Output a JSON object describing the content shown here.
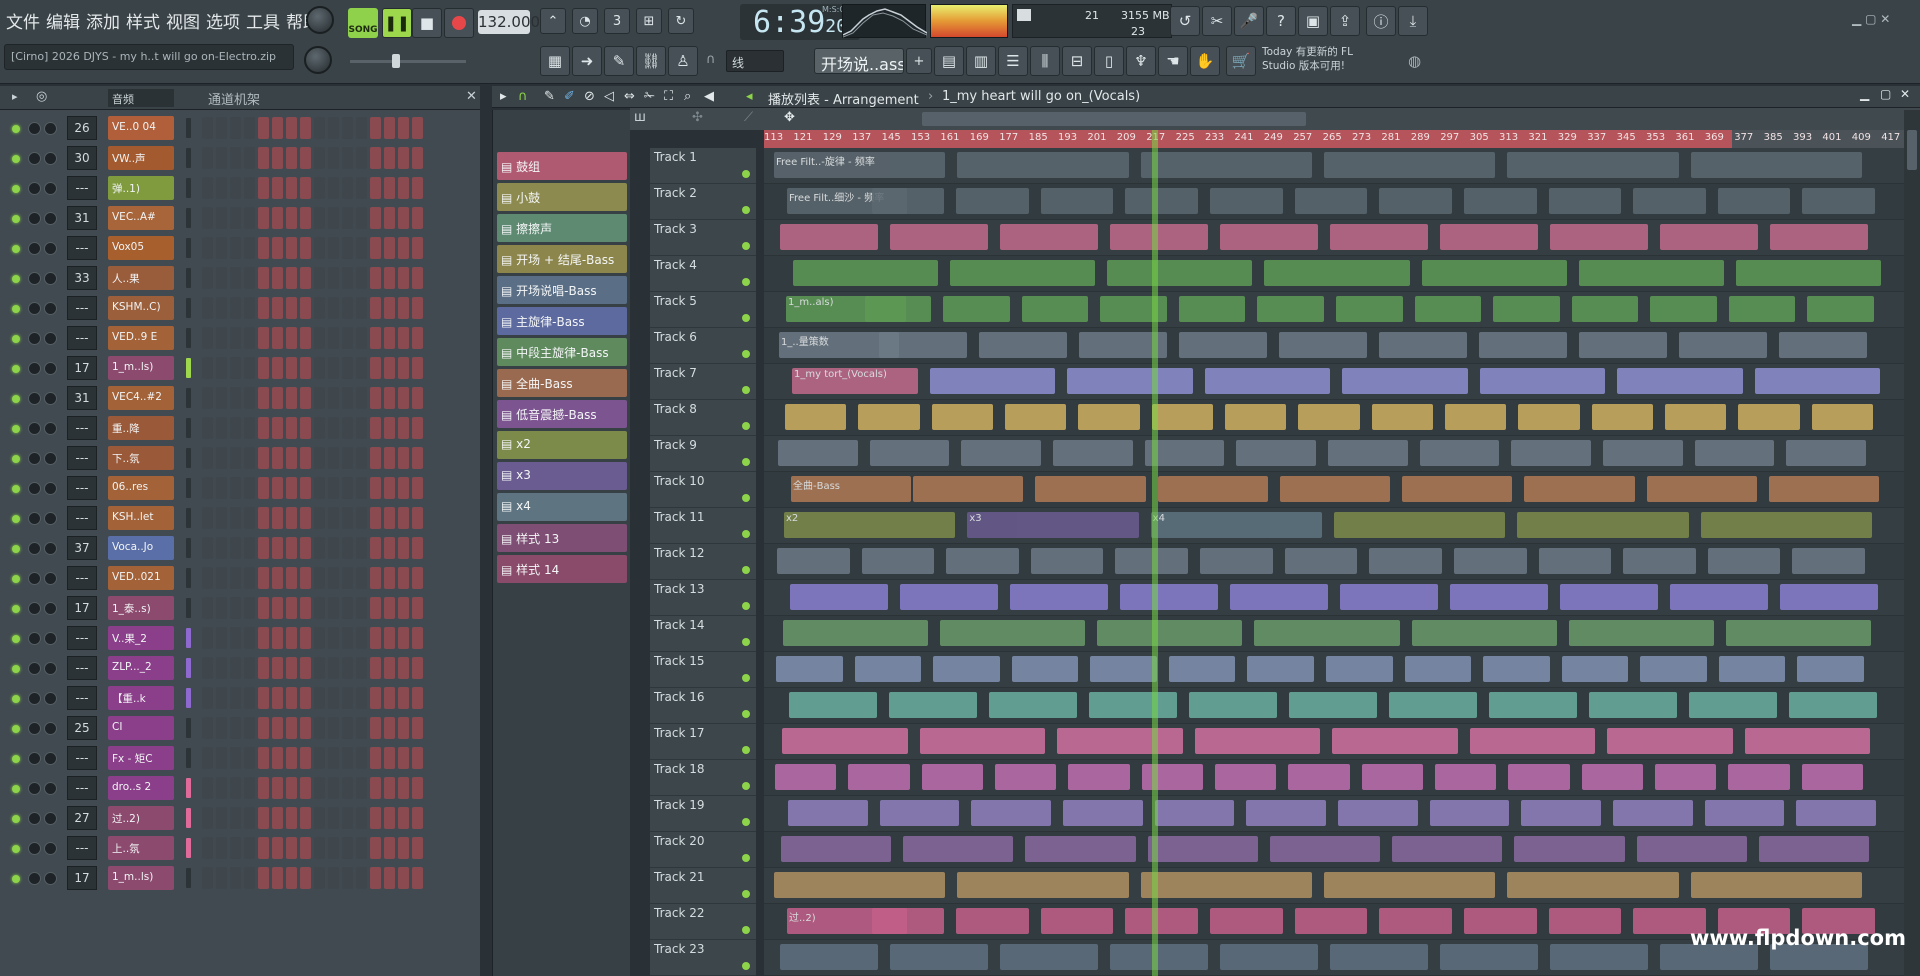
{
  "menu": [
    "文件",
    "编辑",
    "添加",
    "样式",
    "视图",
    "选项",
    "工具",
    "帮助"
  ],
  "song_info": "[Cirno] 2026 DJYS - my h..t will go on-Electro.zip",
  "transport": {
    "mode": "SONG",
    "tempo": "132.000",
    "time_main": "6:39",
    "time_sub": "20",
    "time_unit": "M:S:CS"
  },
  "cpu": {
    "cpu_value": "21",
    "mem": "3155 MB",
    "poly": "23"
  },
  "snap_label": "线",
  "current_pattern": "开场说..ass",
  "hint": {
    "line1": "Today  有更新的 FL",
    "line2": "Studio 版本可用!"
  },
  "rack_header": {
    "filter": "音频",
    "title": "通道机架"
  },
  "channels": [
    {
      "num": "26",
      "name": "VE..0 04",
      "color": "#b05f3a"
    },
    {
      "num": "30",
      "name": "VW..声",
      "color": "#a35a2e"
    },
    {
      "num": "---",
      "name": "弹..1)",
      "color": "#7f9b3e"
    },
    {
      "num": "31",
      "name": "VEC..A#",
      "color": "#a8653a"
    },
    {
      "num": "---",
      "name": "Vox05",
      "color": "#a85f2e"
    },
    {
      "num": "33",
      "name": "人..果",
      "color": "#9a5d3c"
    },
    {
      "num": "---",
      "name": "KSHM..C)",
      "color": "#9b5f3b"
    },
    {
      "num": "---",
      "name": "VED..9 E",
      "color": "#a36238"
    },
    {
      "num": "17",
      "name": "1_m..ls)",
      "color": "#8c4a6e"
    },
    {
      "num": "31",
      "name": "VEC4..#2",
      "color": "#a36238"
    },
    {
      "num": "---",
      "name": "重..降",
      "color": "#9a5a3a"
    },
    {
      "num": "---",
      "name": "下..氛",
      "color": "#9a5a3a"
    },
    {
      "num": "---",
      "name": "06..res",
      "color": "#a36238"
    },
    {
      "num": "---",
      "name": "KSH..let",
      "color": "#a36238"
    },
    {
      "num": "37",
      "name": "Voca..Jo",
      "color": "#5a6fa8"
    },
    {
      "num": "---",
      "name": "VED..021",
      "color": "#a36238"
    },
    {
      "num": "17",
      "name": "1_泰..s)",
      "color": "#8c4a6e"
    },
    {
      "num": "---",
      "name": "V..果_2",
      "color": "#8b3f8a"
    },
    {
      "num": "---",
      "name": "ZLP..._2",
      "color": "#8b3f8a"
    },
    {
      "num": "---",
      "name": "【重..k",
      "color": "#8b3f8a"
    },
    {
      "num": "25",
      "name": "CI",
      "color": "#8b3f8a"
    },
    {
      "num": "---",
      "name": "Fx - 矩C",
      "color": "#8b3f8a"
    },
    {
      "num": "---",
      "name": "dro..s 2",
      "color": "#8b3f8a"
    },
    {
      "num": "27",
      "name": "过..2)",
      "color": "#8c4a6e"
    },
    {
      "num": "---",
      "name": "上..氛",
      "color": "#8c4a6e"
    },
    {
      "num": "17",
      "name": "1_m..ls)",
      "color": "#8c4a6e"
    }
  ],
  "patterns": [
    {
      "name": "鼓组",
      "color": "#b05a72"
    },
    {
      "name": "小鼓",
      "color": "#8c8a4e"
    },
    {
      "name": "擦擦声",
      "color": "#5e8a72"
    },
    {
      "name": "开场 + 结尾-Bass",
      "color": "#8d864c"
    },
    {
      "name": "开场说唱-Bass",
      "color": "#5a6f86"
    },
    {
      "name": "主旋律-Bass",
      "color": "#5d6aa0"
    },
    {
      "name": "中段主旋律-Bass",
      "color": "#5f8a5e"
    },
    {
      "name": "全曲-Bass",
      "color": "#9a6a50"
    },
    {
      "name": "低音震撼-Bass",
      "color": "#7c5590"
    },
    {
      "name": "x2",
      "color": "#7d8b4a"
    },
    {
      "name": "x3",
      "color": "#6a5c90"
    },
    {
      "name": "x4",
      "color": "#5e7480"
    },
    {
      "name": "样式 13",
      "color": "#7e4e74"
    },
    {
      "name": "样式 14",
      "color": "#8a4a6a"
    }
  ],
  "playlist": {
    "title": "播放列表 - Arrangement",
    "crumb": "1_my heart will go on_(Vocals)"
  },
  "ruler_marks": [
    "113",
    "121",
    "129",
    "137",
    "145",
    "153",
    "161",
    "169",
    "177",
    "185",
    "193",
    "201",
    "209",
    "217",
    "225",
    "233",
    "241",
    "249",
    "257",
    "265",
    "273",
    "281",
    "289",
    "297",
    "305",
    "313",
    "321",
    "329",
    "337",
    "345",
    "353",
    "361",
    "369",
    "377",
    "385",
    "393",
    "401",
    "409",
    "417"
  ],
  "tracks": [
    "Track 1",
    "Track 2",
    "Track 3",
    "Track 4",
    "Track 5",
    "Track 6",
    "Track 7",
    "Track 8",
    "Track 9",
    "Track 10",
    "Track 11",
    "Track 12",
    "Track 13",
    "Track 14",
    "Track 15",
    "Track 16",
    "Track 17",
    "Track 18",
    "Track 19",
    "Track 20",
    "Track 21",
    "Track 22",
    "Track 23"
  ],
  "clips": [
    {
      "track": 0,
      "label": "Free Filt..-旋律 - 频率",
      "color": "#5c6870"
    },
    {
      "track": 1,
      "label": "Free Filt..细沙 - 频率",
      "color": "#5c6870"
    },
    {
      "track": 4,
      "label": "1_m..als)",
      "color": "#5d9a55"
    },
    {
      "track": 5,
      "label": "1_..量策数",
      "color": "#6c7a86"
    },
    {
      "track": 6,
      "label": "1_my tort_(Vocals)",
      "color": "#c06a8a"
    },
    {
      "track": 9,
      "label": "全曲-Bass",
      "color": "#b07a56"
    },
    {
      "track": 10,
      "label": "x2",
      "color": "#7d8b4a"
    },
    {
      "track": 10,
      "label": "x3",
      "color": "#6a5c90"
    },
    {
      "track": 10,
      "label": "x4",
      "color": "#5e7480"
    },
    {
      "track": 21,
      "label": "过..2)",
      "color": "#c45f8a"
    }
  ],
  "watermark": "www.flpdown.com"
}
